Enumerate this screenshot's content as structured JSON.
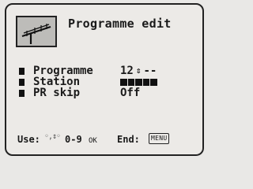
{
  "header": {
    "title": "Programme edit",
    "icon": "antenna-icon"
  },
  "settings": [
    {
      "label": "Programme",
      "value": "12",
      "updown": "⇕",
      "extra": "--"
    },
    {
      "label": "Station",
      "value_blocks": 5
    },
    {
      "label": "PR skip",
      "value": "Off"
    }
  ],
  "footer": {
    "use_label": "Use:",
    "use_icons": "◦,↕◦",
    "use_digits": "0-9",
    "ok_label": "OK",
    "end_label": "End:",
    "menu_key": "MENU"
  }
}
